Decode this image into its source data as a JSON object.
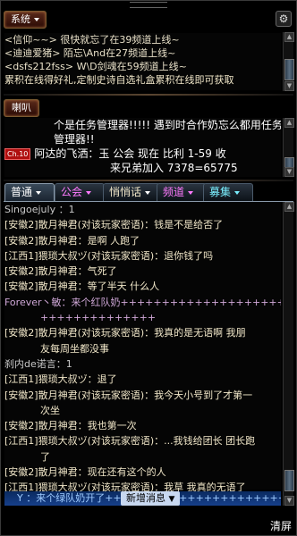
{
  "system_section": {
    "button_label": "系统",
    "lines": [
      {
        "text": "<信仰~~> 很快就忘了在39频道上线~",
        "color": "#e8e0c8"
      },
      {
        "text": "<迪迪爱猪> 陌忘\\And在27频道上线~",
        "color": "#e8e0c8"
      },
      {
        "text": "<dsfs212fss> W\\D剑魂在59频道上线~",
        "color": "#e8e0c8"
      },
      {
        "text": "累积在线得好礼,定制史诗自选礼盒累积在线即可获取",
        "color": "#f0e6c8"
      }
    ]
  },
  "horn_section": {
    "button_label": "喇叭",
    "lines": [
      "个是任务管理器!!!!! 遇到时合作奶忘么都用任务",
      "管理器!!",
      "阿达的飞洒：玉   公会 现在   比利   1-59   收",
      "来兄弟加入    7378=65775"
    ],
    "badge_text": "Ch.10"
  },
  "tabs": [
    {
      "label": "普通",
      "color": "#ffffff"
    },
    {
      "label": "公会",
      "color": "#ff7aff"
    },
    {
      "label": "悄悄话",
      "color": "#ffffff"
    },
    {
      "label": "频道",
      "color": "#ff7aff"
    },
    {
      "label": "募集",
      "color": "#7aefff"
    }
  ],
  "chat": [
    {
      "text": "Singoejuly ：1",
      "color": "#c8c8c8",
      "indent": false
    },
    {
      "text": "[安徽2]散月神君(对该玩家密语)：钱是不是给否了",
      "color": "#f0e6c8",
      "indent": false
    },
    {
      "text": "[安徽2]散月神君：是啊  人跑了",
      "color": "#f0e6c8",
      "indent": false
    },
    {
      "text": "[江西1]猥琐大叔ヅ(对该玩家密语)：退你钱了吗",
      "color": "#f0e6c8",
      "indent": false
    },
    {
      "text": "[安徽2]散月神君：气死了",
      "color": "#f0e6c8",
      "indent": false
    },
    {
      "text": "[安徽2]散月神君：等了半天  什么人",
      "color": "#f0e6c8",
      "indent": false
    },
    {
      "text": "Forever丶敏：来个红队奶+++++++++++++++++++++++++++++",
      "color": "#d0a8d8",
      "indent": false
    },
    {
      "text": "++++++++++++++",
      "color": "#d0a8d8",
      "indent": true
    },
    {
      "text": "[安徽2]散月神君(对该玩家密语)：我真的是无语啊 我朋",
      "color": "#f0e6c8",
      "indent": false
    },
    {
      "text": "友每周坐都没事",
      "color": "#f0e6c8",
      "indent": true
    },
    {
      "text": "刹内de诺言：1",
      "color": "#c8c8c8",
      "indent": false
    },
    {
      "text": "[江西1]猥琐大叔ヅ：退了",
      "color": "#f0e6c8",
      "indent": false
    },
    {
      "text": "[安徽2]散月神君(对该玩家密语)：我今天小号到了才第一",
      "color": "#f0e6c8",
      "indent": false
    },
    {
      "text": "次坐",
      "color": "#f0e6c8",
      "indent": true
    },
    {
      "text": "[安徽2]散月神君：我也第一次",
      "color": "#f0e6c8",
      "indent": false
    },
    {
      "text": "[江西1]猥琐大叔ヅ(对该玩家密语)：...我钱给团长 团长跑",
      "color": "#f0e6c8",
      "indent": false
    },
    {
      "text": "了",
      "color": "#f0e6c8",
      "indent": true
    },
    {
      "text": "[安徽2]散月神君：现在还有这个的人",
      "color": "#f0e6c8",
      "indent": false
    },
    {
      "text": "[江西1]猥琐大叔ヅ(对该玩家密语)：我草 我真的无语了",
      "color": "#f0e6c8",
      "indent": false
    }
  ],
  "bottom": {
    "ticker_text": "Y  ：来个绿队奶开了++++++++++++++++++++++++++++++",
    "new_message_label": "新增消息"
  },
  "clear_label": "清屏"
}
